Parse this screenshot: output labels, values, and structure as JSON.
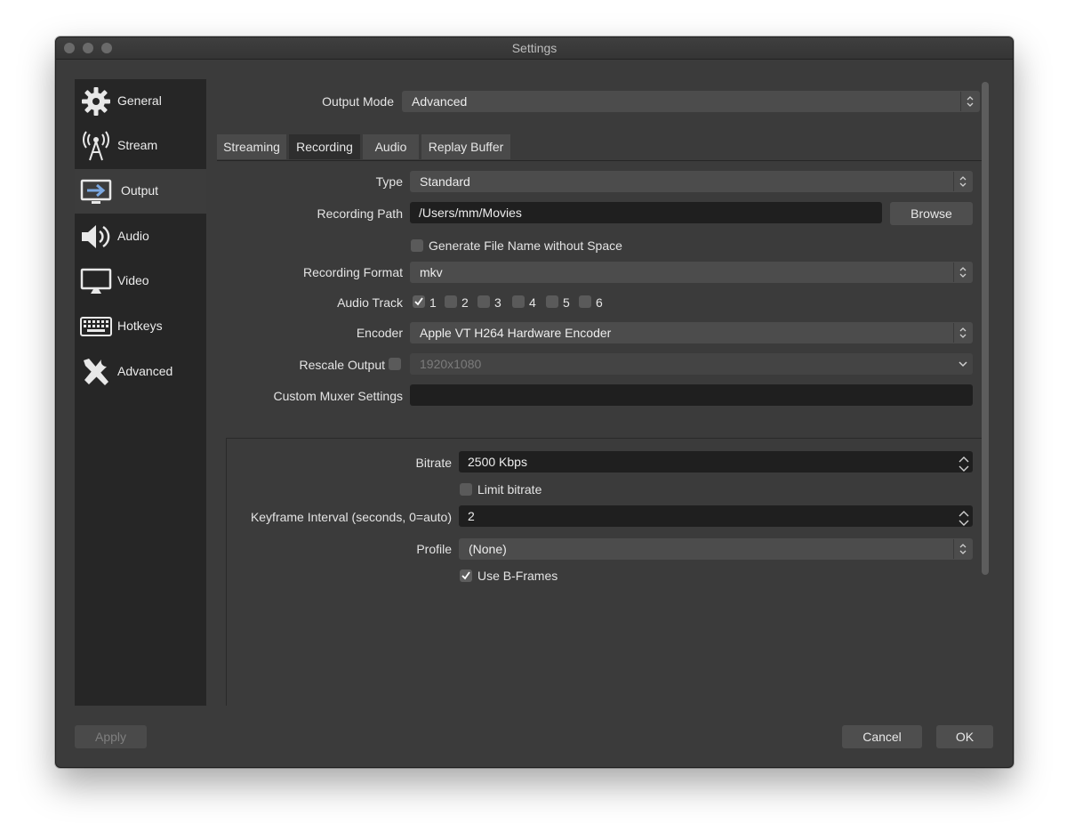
{
  "window": {
    "title": "Settings"
  },
  "sidebar": {
    "items": [
      {
        "label": "General",
        "icon": "gear-icon",
        "selected": false
      },
      {
        "label": "Stream",
        "icon": "broadcast-tower-icon",
        "selected": false
      },
      {
        "label": "Output",
        "icon": "monitor-arrow-icon",
        "selected": true
      },
      {
        "label": "Audio",
        "icon": "speaker-icon",
        "selected": false
      },
      {
        "label": "Video",
        "icon": "monitor-icon",
        "selected": false
      },
      {
        "label": "Hotkeys",
        "icon": "keyboard-icon",
        "selected": false
      },
      {
        "label": "Advanced",
        "icon": "tools-icon",
        "selected": false
      }
    ]
  },
  "output_mode": {
    "label": "Output Mode",
    "value": "Advanced"
  },
  "tabs": [
    {
      "label": "Streaming",
      "active": false
    },
    {
      "label": "Recording",
      "active": true
    },
    {
      "label": "Audio",
      "active": false
    },
    {
      "label": "Replay Buffer",
      "active": false
    }
  ],
  "recording": {
    "type": {
      "label": "Type",
      "value": "Standard"
    },
    "path": {
      "label": "Recording Path",
      "value": "/Users/mm/Movies",
      "browse": "Browse"
    },
    "no_space": {
      "label": "Generate File Name without Space",
      "checked": false
    },
    "format": {
      "label": "Recording Format",
      "value": "mkv"
    },
    "audio_track": {
      "label": "Audio Track",
      "tracks": [
        {
          "num": "1",
          "checked": true
        },
        {
          "num": "2",
          "checked": false
        },
        {
          "num": "3",
          "checked": false
        },
        {
          "num": "4",
          "checked": false
        },
        {
          "num": "5",
          "checked": false
        },
        {
          "num": "6",
          "checked": false
        }
      ]
    },
    "encoder": {
      "label": "Encoder",
      "value": "Apple VT H264 Hardware Encoder"
    },
    "rescale": {
      "label": "Rescale Output",
      "checked": false,
      "value": "1920x1080"
    },
    "muxer": {
      "label": "Custom Muxer Settings",
      "value": ""
    }
  },
  "encoder_settings": {
    "bitrate": {
      "label": "Bitrate",
      "value": "2500 Kbps"
    },
    "limit_bitrate": {
      "label": "Limit bitrate",
      "checked": false
    },
    "keyframe": {
      "label": "Keyframe Interval (seconds, 0=auto)",
      "value": "2"
    },
    "profile": {
      "label": "Profile",
      "value": "(None)"
    },
    "bframes": {
      "label": "Use B-Frames",
      "checked": true
    }
  },
  "footer": {
    "apply": "Apply",
    "cancel": "Cancel",
    "ok": "OK"
  },
  "colors": {
    "window_bg": "#3b3b3b",
    "sidebar_bg": "#262626",
    "selected_bg": "#3c3c3c",
    "field_bg": "#4c4c4c",
    "input_bg": "#1f1f1f"
  }
}
